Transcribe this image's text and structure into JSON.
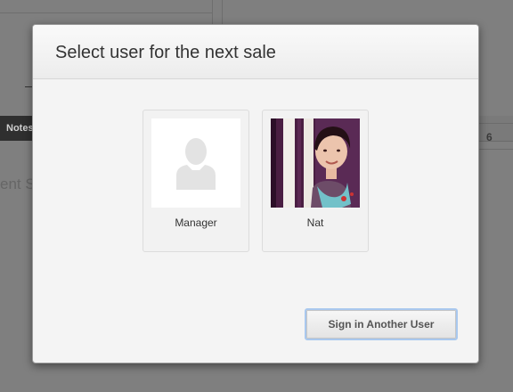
{
  "background": {
    "tab_label": "Notes",
    "badge_number": "6",
    "faint_text": "ent S"
  },
  "modal": {
    "title": "Select user for the next sale",
    "users": [
      {
        "name": "Manager",
        "avatar": "placeholder-person-icon"
      },
      {
        "name": "Nat",
        "avatar": "user-photo"
      }
    ],
    "sign_in_label": "Sign in Another User"
  }
}
